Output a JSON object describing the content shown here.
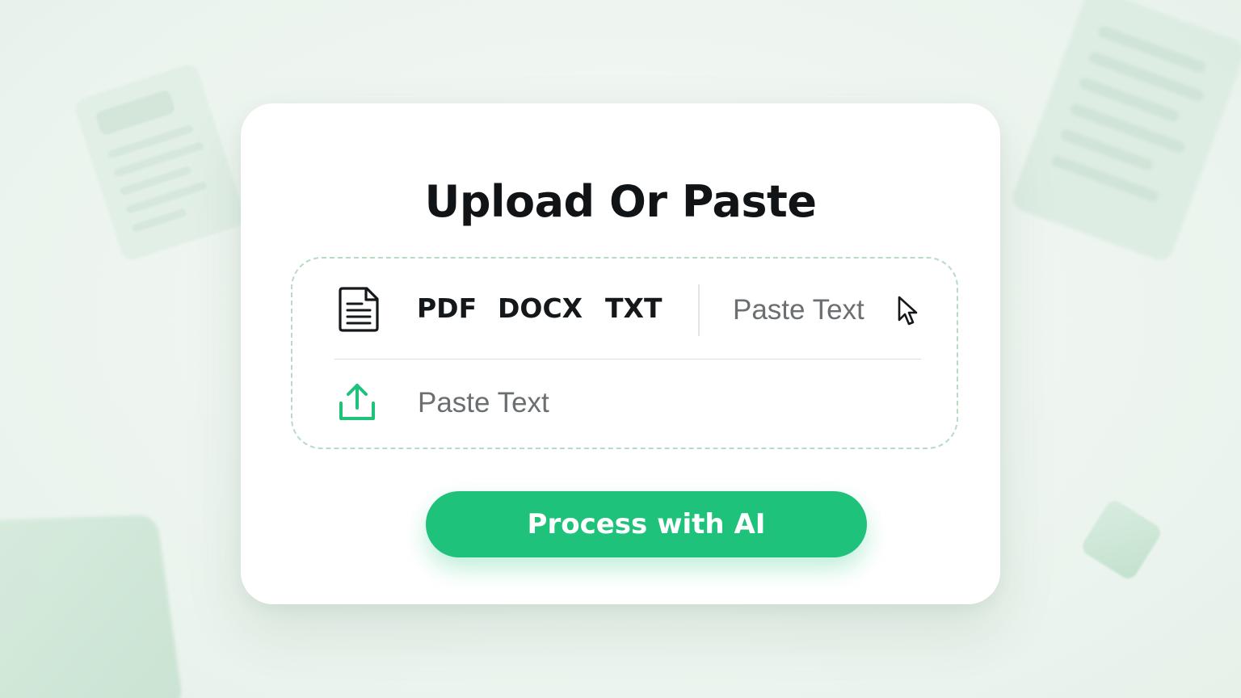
{
  "card": {
    "title": "Upload Or Paste"
  },
  "dropzone": {
    "file_icon": "document-icon",
    "formats": [
      "PDF",
      "DOCX",
      "TXT"
    ],
    "paste_option_label": "Paste Text",
    "cursor_icon": "mouse-pointer-icon",
    "upload_icon": "upload-icon",
    "paste_input_placeholder": "Paste Text"
  },
  "actions": {
    "process_label": "Process with AI"
  },
  "colors": {
    "accent": "#1ec27a",
    "dropzone_border": "#b6dcc4",
    "background": "#eef5f0"
  }
}
